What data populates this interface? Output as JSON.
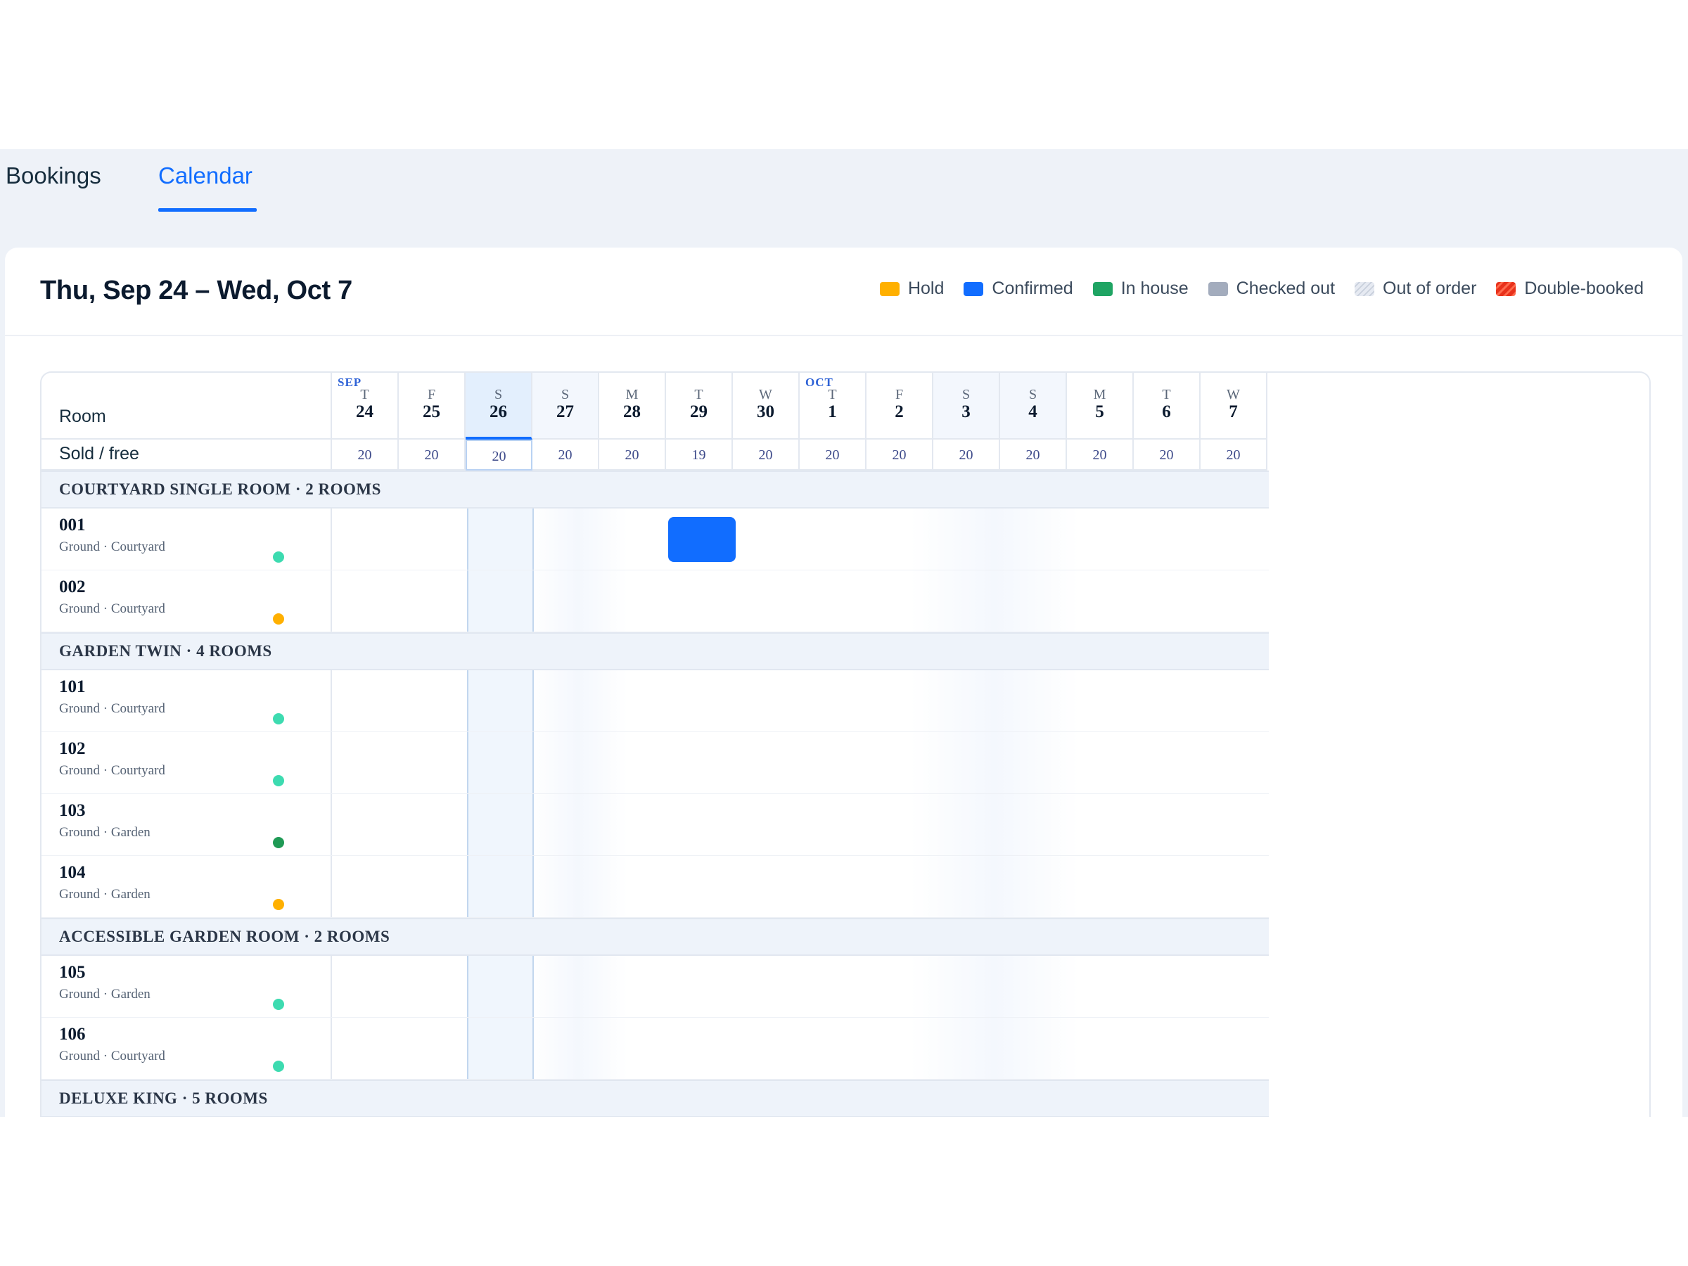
{
  "tabs": [
    {
      "label": "Bookings",
      "active": false
    },
    {
      "label": "Calendar",
      "active": true
    }
  ],
  "header": {
    "range_title": "Thu, Sep 24 – Wed, Oct 7"
  },
  "legend": [
    {
      "label": "Hold",
      "color": "#ffb000"
    },
    {
      "label": "Confirmed",
      "color": "#116dff"
    },
    {
      "label": "In house",
      "color": "#1fa463"
    },
    {
      "label": "Checked out",
      "color": "#a3acbd"
    },
    {
      "label": "Out of order",
      "color": "#d6dbe5"
    },
    {
      "label": "Double-booked",
      "color": "#e8321c"
    }
  ],
  "grid": {
    "room_header": "Room",
    "sold_header": "Sold / free",
    "days": [
      {
        "month": "SEP",
        "dow": "T",
        "day": "24",
        "sold": "20"
      },
      {
        "month": "",
        "dow": "F",
        "day": "25",
        "sold": "20"
      },
      {
        "month": "",
        "dow": "S",
        "day": "26",
        "sold": "20",
        "today": true
      },
      {
        "month": "",
        "dow": "S",
        "day": "27",
        "sold": "20"
      },
      {
        "month": "",
        "dow": "M",
        "day": "28",
        "sold": "20"
      },
      {
        "month": "",
        "dow": "T",
        "day": "29",
        "sold": "19"
      },
      {
        "month": "",
        "dow": "W",
        "day": "30",
        "sold": "20"
      },
      {
        "month": "OCT",
        "dow": "T",
        "day": "1",
        "sold": "20"
      },
      {
        "month": "",
        "dow": "F",
        "day": "2",
        "sold": "20"
      },
      {
        "month": "",
        "dow": "S",
        "day": "3",
        "sold": "20"
      },
      {
        "month": "",
        "dow": "S",
        "day": "4",
        "sold": "20"
      },
      {
        "month": "",
        "dow": "M",
        "day": "5",
        "sold": "20"
      },
      {
        "month": "",
        "dow": "T",
        "day": "6",
        "sold": "20"
      },
      {
        "month": "",
        "dow": "W",
        "day": "7",
        "sold": "20"
      }
    ],
    "groups": [
      {
        "label": "COURTYARD SINGLE ROOM · 2 ROOMS",
        "rooms": [
          {
            "number": "001",
            "location": "Ground · Courtyard",
            "status": "teal"
          },
          {
            "number": "002",
            "location": "Ground · Courtyard",
            "status": "amber"
          }
        ]
      },
      {
        "label": "GARDEN TWIN · 4 ROOMS",
        "rooms": [
          {
            "number": "101",
            "location": "Ground · Courtyard",
            "status": "teal"
          },
          {
            "number": "102",
            "location": "Ground · Courtyard",
            "status": "teal"
          },
          {
            "number": "103",
            "location": "Ground · Garden",
            "status": "green"
          },
          {
            "number": "104",
            "location": "Ground · Garden",
            "status": "amber"
          }
        ]
      },
      {
        "label": "ACCESSIBLE GARDEN ROOM · 2 ROOMS",
        "rooms": [
          {
            "number": "105",
            "location": "Ground · Garden",
            "status": "teal"
          },
          {
            "number": "106",
            "location": "Ground · Courtyard",
            "status": "teal"
          }
        ]
      },
      {
        "label": "DELUXE KING · 5 ROOMS",
        "rooms": []
      }
    ],
    "bookings": [
      {
        "room": "001",
        "day": "29",
        "status": "confirmed",
        "color": "#116dff"
      }
    ]
  }
}
